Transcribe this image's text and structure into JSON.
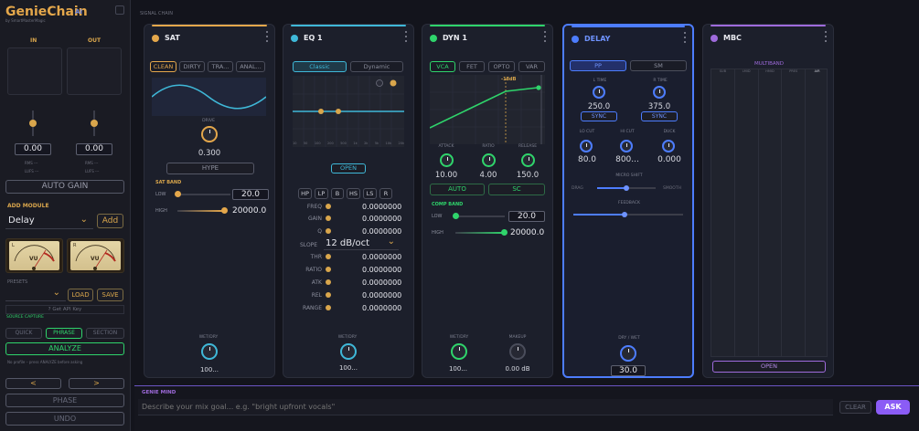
{
  "app": {
    "title": "GenieChain",
    "ai_badge": "AI",
    "subtitle": "by SmartMasterMagic"
  },
  "io": {
    "in_label": "IN",
    "out_label": "OUT",
    "in_value": "0.00",
    "out_value": "0.00",
    "rms": "RMS ---",
    "lufs": "LUFS ---",
    "rms2": "RMS ---",
    "lufs2": "LUFS ---"
  },
  "sidebar": {
    "auto_gain": "AUTO GAIN",
    "add_module_label": "ADD MODULE",
    "module_select": "Delay",
    "add_button": "Add",
    "presets_label": "PRESETS",
    "load": "LOAD",
    "save": "SAVE",
    "api_key": "Get API Key",
    "source_capture": "SOURCE CAPTURE",
    "quick": "QUICK",
    "phrase": "PHRASE",
    "section": "SECTION",
    "analyze": "ANALYZE",
    "analyze_hint": "No profile – press ANALYZE before asking",
    "prev": "<",
    "next": ">",
    "phase": "PHASE",
    "undo": "UNDO"
  },
  "vu": {
    "left_label": "L",
    "right_label": "R",
    "left_text": "VU",
    "right_text": "VU"
  },
  "main": {
    "signal_chain_label": "SIGNAL CHAIN"
  },
  "sat": {
    "name": "SAT",
    "color": "#e4a74b",
    "tabs": [
      "CLEAN",
      "DIRTY",
      "TRA...",
      "ANAL..."
    ],
    "drive_label": "DRIVE",
    "drive_value": "0.300",
    "hype": "HYPE",
    "band_label": "SAT BAND",
    "low_label": "LOW",
    "low_value": "20.0",
    "high_label": "HIGH",
    "high_value": "20000.0",
    "wet_label": "WET/DRY",
    "wet_value": "100..."
  },
  "eq": {
    "name": "EQ 1",
    "color": "#3fb8d8",
    "tabs": [
      "Classic",
      "Dynamic"
    ],
    "axis": [
      "10",
      "50",
      "100",
      "200",
      "500",
      "1k",
      "2k",
      "5k",
      "10k",
      "20k"
    ],
    "open": "OPEN",
    "filters": [
      "HP",
      "LP",
      "B",
      "HS",
      "LS",
      "R"
    ],
    "params": [
      {
        "label": "FREQ",
        "value": "0.0000000"
      },
      {
        "label": "GAIN",
        "value": "0.0000000"
      },
      {
        "label": "Q",
        "value": "0.0000000"
      }
    ],
    "slope_label": "SLOPE",
    "slope_value": "12 dB/oct",
    "params2": [
      {
        "label": "THR",
        "value": "0.0000000"
      },
      {
        "label": "RATIO",
        "value": "0.0000000"
      },
      {
        "label": "ATK",
        "value": "0.0000000"
      },
      {
        "label": "REL",
        "value": "0.0000000"
      },
      {
        "label": "RANGE",
        "value": "0.0000000"
      }
    ],
    "wet_label": "WET/DRY",
    "wet_value": "100..."
  },
  "dyn": {
    "name": "DYN 1",
    "color": "#2fd46b",
    "tabs": [
      "VCA",
      "FET",
      "OPTO",
      "VAR"
    ],
    "threshold": "-18dB",
    "attack_label": "ATTACK",
    "attack_value": "10.00",
    "ratio_label": "RATIO",
    "ratio_value": "4.00",
    "release_label": "RELEASE",
    "release_value": "150.0",
    "auto": "AUTO",
    "sc": "SC",
    "comp_band": "COMP BAND",
    "low_label": "LOW",
    "low_value": "20.0",
    "high_label": "HIGH",
    "high_value": "20000.0",
    "wet_label": "WET/DRY",
    "wet_value": "100...",
    "makeup_label": "MAKEUP",
    "makeup_value": "0.00 dB"
  },
  "delay": {
    "name": "DELAY",
    "color": "#4d7dff",
    "tabs": [
      "PP",
      "SM"
    ],
    "ltime_label": "L TIME",
    "ltime_value": "250.0",
    "lsync": "SYNC",
    "rtime_label": "R TIME",
    "rtime_value": "375.0",
    "rsync": "SYNC",
    "locut_label": "LO CUT",
    "locut_value": "80.0",
    "hicut_label": "HI CUT",
    "hicut_value": "800...",
    "duck_label": "DUCK",
    "duck_value": "0.000",
    "micro_label": "MICRO SHIFT",
    "drag": "DRAG",
    "smooth": "SMOOTH",
    "micro_level": 0.5,
    "feedback_label": "FEEDBACK",
    "feedback_level": 0.47,
    "drywet_label": "DRY / WET",
    "drywet_value": "30.0"
  },
  "mbc": {
    "name": "MBC",
    "color": "#9f6bdc",
    "title": "MULTIBAND",
    "bands": [
      "SUB",
      "LMID",
      "HMID",
      "PRES",
      "AIR"
    ],
    "open": "OPEN"
  },
  "genie": {
    "label": "GENIE MIND",
    "placeholder": "Describe your mix goal... e.g. \"bright upfront vocals\"",
    "clear": "CLEAR",
    "ask": "ASK"
  }
}
